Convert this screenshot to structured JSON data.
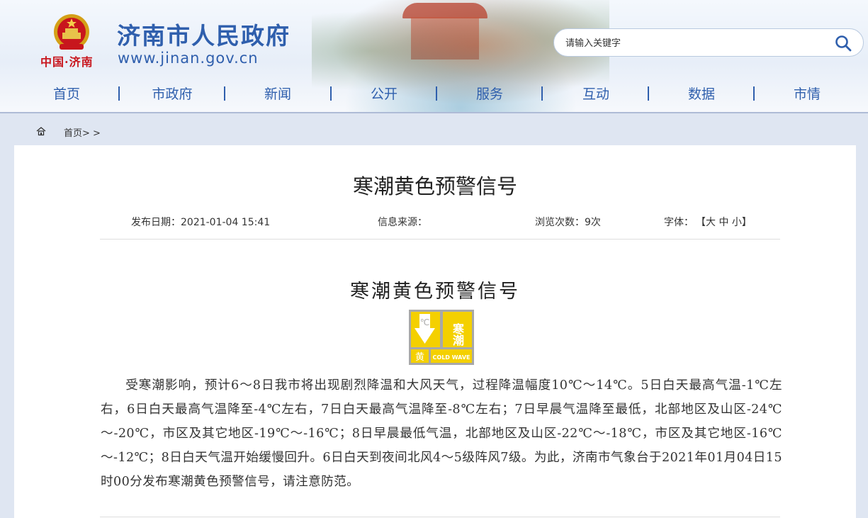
{
  "header": {
    "emblem_text": "中国·济南",
    "site_title": "济南市人民政府",
    "site_url": "www.jinan.gov.cn",
    "search": {
      "placeholder": "请输入关键字"
    },
    "nav": [
      "首页",
      "市政府",
      "新闻",
      "公开",
      "服务",
      "互动",
      "数据",
      "市情"
    ]
  },
  "breadcrumb": {
    "text": "首页> >"
  },
  "article": {
    "page_title": "寒潮黄色预警信号",
    "meta": {
      "publish_date": "发布日期：2021-01-04 15:41",
      "source": "信息来源：",
      "views": "浏览次数：9次",
      "font_label": "字体：",
      "font_sizes": "【大 中 小】"
    },
    "title": "寒潮黄色预警信号",
    "signal_icon": {
      "symbol": "℃",
      "label_top": "寒潮",
      "label_left": "黄",
      "label_right": "COLD WAVE",
      "color": "#f4d000"
    },
    "body": "受寒潮影响，预计6～8日我市将出现剧烈降温和大风天气，过程降温幅度10℃～14℃。5日白天最高气温-1℃左右，6日白天最高气温降至-4℃左右，7日白天最高气温降至-8℃左右；7日早晨气温降至最低，北部地区及山区-24℃～-20℃，市区及其它地区-19℃～-16℃；8日早晨最低气温，北部地区及山区-22℃～-18℃，市区及其它地区-16℃～-12℃；8日白天气温开始缓慢回升。6日白天到夜间北风4～5级阵风7级。为此，济南市气象台于2021年01月04日15时00分发布寒潮黄色预警信号，请注意防范。"
  },
  "colors": {
    "brand_blue": "#2f5fad",
    "emblem_red": "#c8161d",
    "warning_yellow": "#f4d000"
  }
}
